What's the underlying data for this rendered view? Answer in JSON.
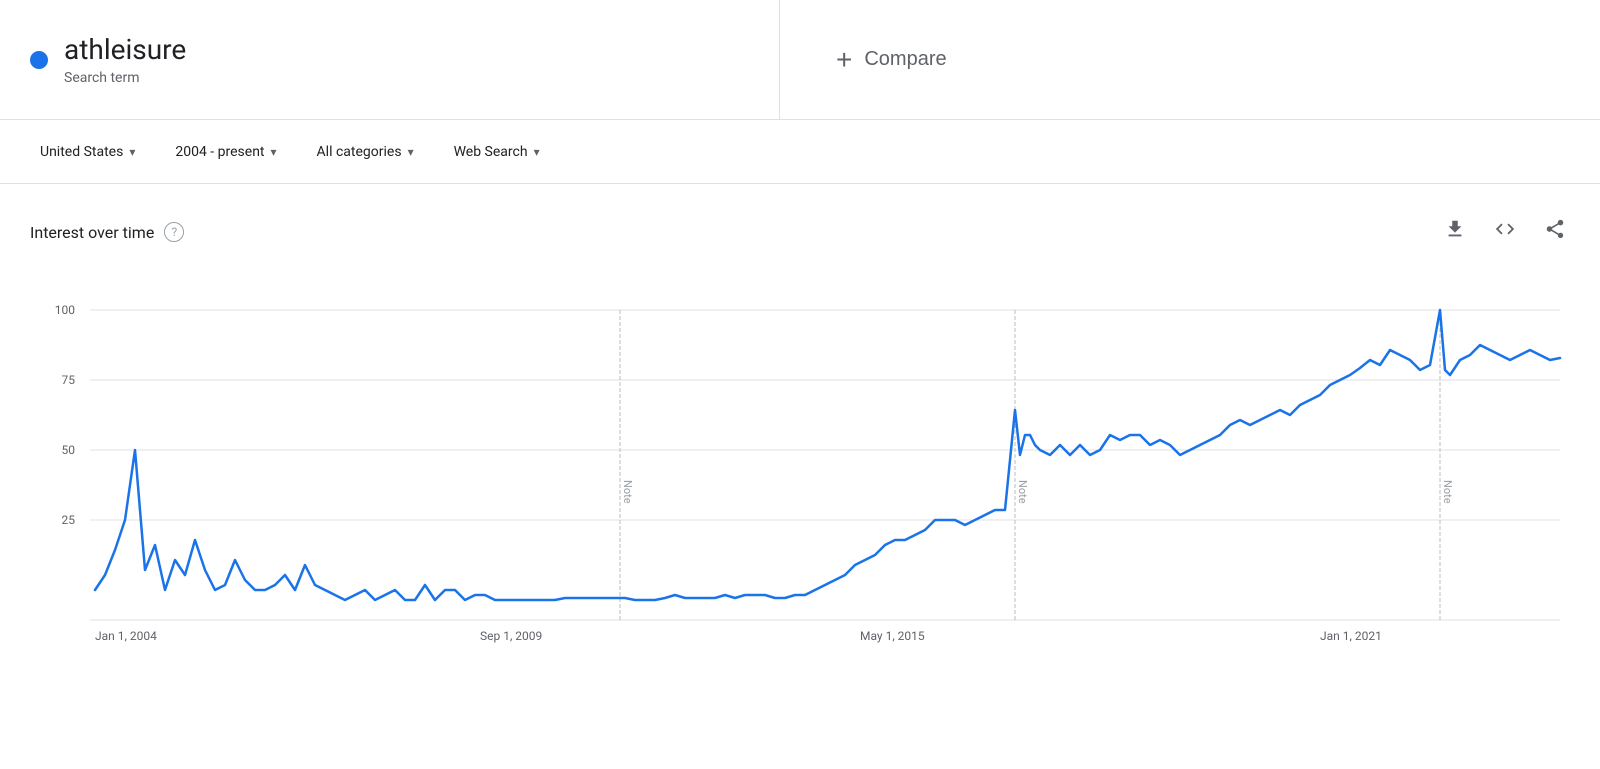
{
  "header": {
    "search_term": "athleisure",
    "term_type": "Search term",
    "compare_label": "Compare",
    "compare_plus": "+"
  },
  "filters": {
    "region": "United States",
    "date_range": "2004 - present",
    "categories": "All categories",
    "search_type": "Web Search"
  },
  "chart": {
    "title": "Interest over time",
    "help_symbol": "?",
    "y_labels": [
      "100",
      "75",
      "50",
      "25"
    ],
    "x_labels": [
      "Jan 1, 2004",
      "Sep 1, 2009",
      "May 1, 2015",
      "Jan 1, 2021"
    ],
    "note_label": "Note",
    "download_icon": "⬇",
    "embed_icon": "<>",
    "share_icon": "⋮"
  },
  "colors": {
    "blue_dot": "#1a73e8",
    "line": "#1a73e8",
    "grid": "#e0e0e0",
    "text_secondary": "#5f6368",
    "text_primary": "#202124"
  }
}
